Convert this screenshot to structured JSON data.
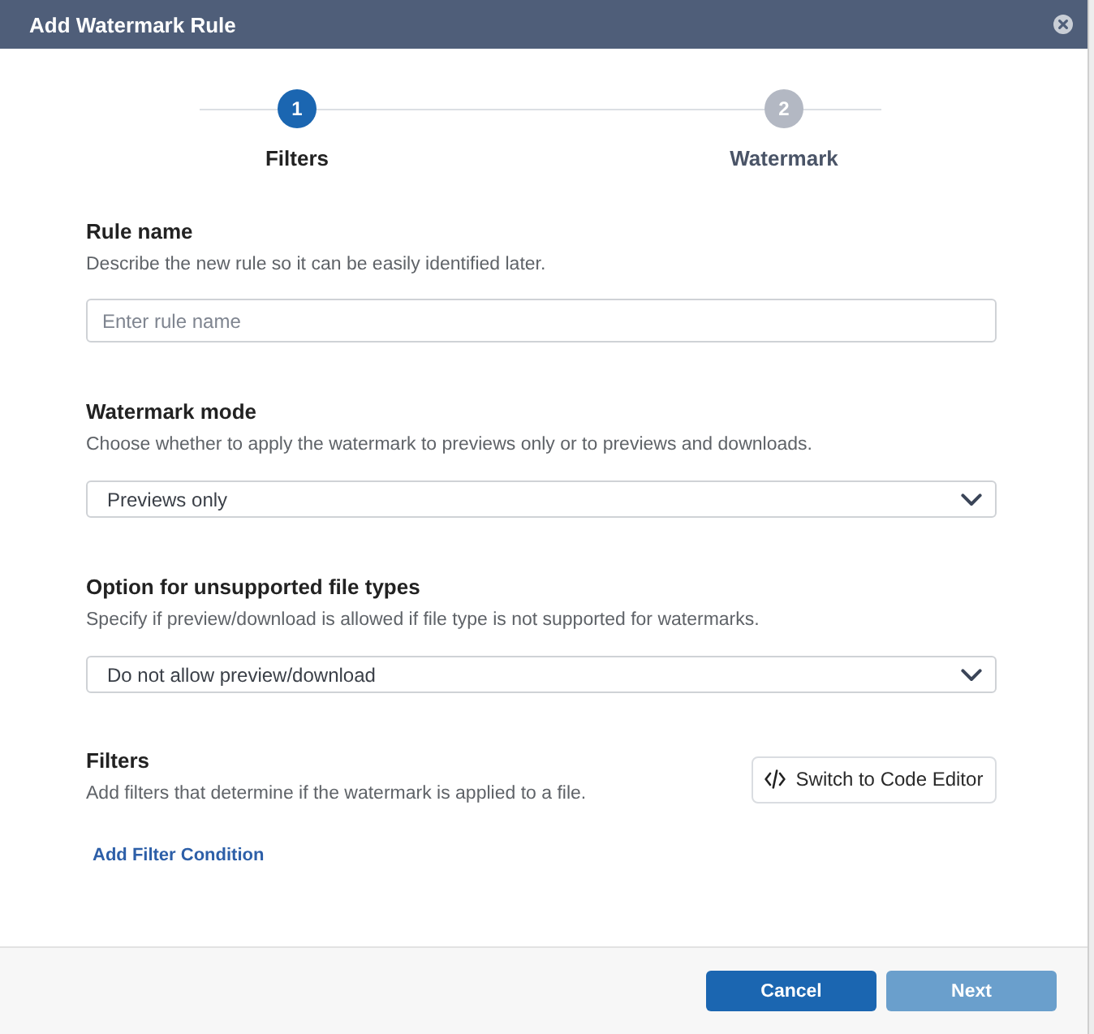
{
  "dialog": {
    "title": "Add Watermark Rule"
  },
  "steps": [
    {
      "number": "1",
      "label": "Filters",
      "selected": true
    },
    {
      "number": "2",
      "label": "Watermark",
      "selected": false
    }
  ],
  "sections": [
    {
      "heading": "Rule name",
      "description": "Describe the new rule so it can be easily identified later.",
      "field": {
        "kind": "text",
        "placeholder": "Enter rule name"
      }
    },
    {
      "heading": "Watermark mode",
      "description": "Choose whether to apply the watermark to previews only or to previews and downloads.",
      "field": {
        "kind": "select",
        "value": "Previews only"
      }
    },
    {
      "heading": "Option for unsupported file types",
      "description": "Specify if preview/download is allowed if file type is not supported for watermarks.",
      "field": {
        "kind": "select",
        "value": "Do not allow preview/download"
      }
    }
  ],
  "filters": {
    "heading": "Filters",
    "description": "Add filters that determine if the watermark is applied to a file.",
    "code_editor_button": "Switch to Code Editor",
    "add_condition_link": "Add Filter Condition"
  },
  "footer": {
    "buttons": [
      {
        "label": "Cancel",
        "disabled": false
      },
      {
        "label": "Next",
        "disabled": true
      }
    ]
  }
}
